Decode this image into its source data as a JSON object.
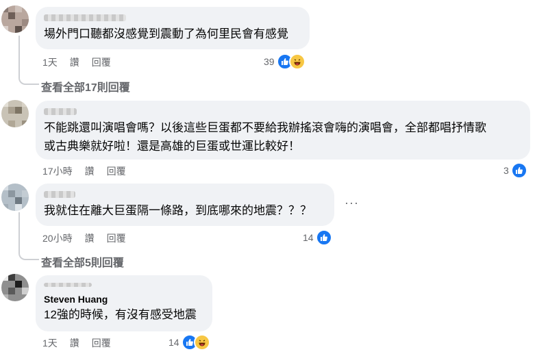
{
  "comments": [
    {
      "author": "",
      "text": "場外門口聽都沒感覺到震動了為何里民會有感覺",
      "time": "1天",
      "like_label": "讚",
      "reply_label": "回覆",
      "reaction_count": "39",
      "reactions": [
        "like-icon",
        "haha-icon"
      ],
      "view_replies": "查看全部17則回覆"
    },
    {
      "author": "",
      "text": "不能跳還叫演唱會嗎？以後這些巨蛋都不要給我辦搖滾會嗨的演唱會，全部都唱抒情歌\n或古典樂就好啦！還是高雄的巨蛋或世運比較好！",
      "time": "17小時",
      "like_label": "讚",
      "reply_label": "回覆",
      "reaction_count": "3",
      "reactions": [
        "like-icon"
      ]
    },
    {
      "author": "",
      "text": "我就住在離大巨蛋隔一條路，到底哪來的地震？？？",
      "time": "20小時",
      "like_label": "讚",
      "reply_label": "回覆",
      "reaction_count": "14",
      "reactions": [
        "like-icon"
      ],
      "view_replies": "查看全部5則回覆",
      "more_icon": "more-horizontal-icon"
    },
    {
      "author": "Steven Huang",
      "text": "12強的時候，有沒有感受地震",
      "time": "1天",
      "like_label": "讚",
      "reply_label": "回覆",
      "reaction_count": "14",
      "reactions": [
        "like-icon",
        "haha-icon"
      ]
    }
  ],
  "colors": {
    "bubble": "#f0f2f5",
    "secondary_text": "#65676b",
    "like_blue": "#1877f2",
    "haha_yellow": "#f7c744"
  }
}
